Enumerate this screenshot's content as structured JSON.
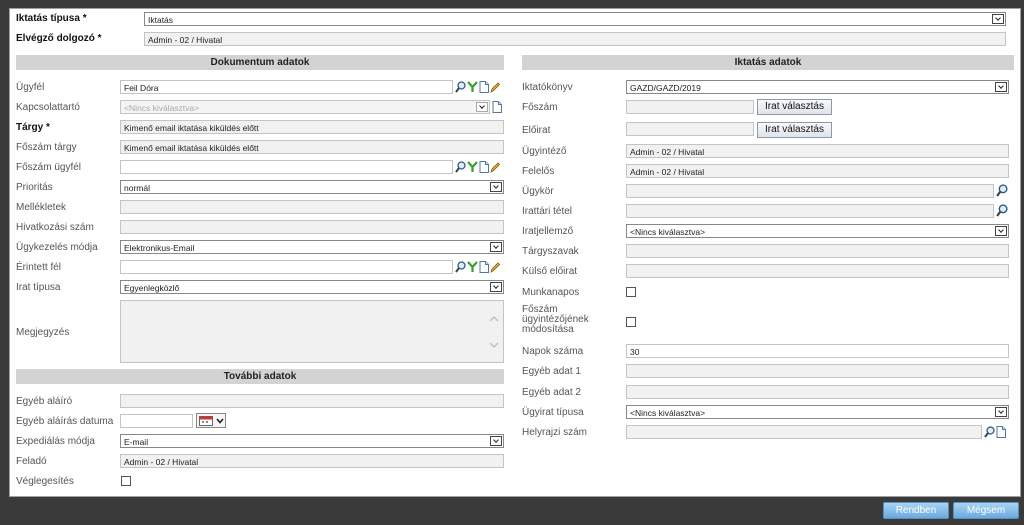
{
  "top": {
    "iktatas_tipusa_label": "Iktatás típusa *",
    "iktatas_tipusa_value": "Iktatás",
    "elvegzo_label": "Elvégző dolgozó *",
    "elvegzo_value": "Admin - 02 / Hivatal"
  },
  "left": {
    "section_title": "Dokumentum adatok",
    "ugyfel": {
      "label": "Ügyfél",
      "value": "Feil Dóra"
    },
    "kapcsolattarto": {
      "label": "Kapcsolattartó",
      "placeholder": "<Nincs kiválasztva>"
    },
    "targy": {
      "label": "Tárgy *",
      "value": "Kimenő email iktatása kiküldés előtt"
    },
    "foszam_targy": {
      "label": "Főszám tárgy",
      "value": "Kimenő email iktatása kiküldés előtt"
    },
    "foszam_ugyfel": {
      "label": "Főszám ügyfél",
      "value": ""
    },
    "prioritas": {
      "label": "Prioritás",
      "value": "normál"
    },
    "mellekletek": {
      "label": "Mellékletek",
      "value": ""
    },
    "hivatkozasi_szam": {
      "label": "Hivatkozási szám",
      "value": ""
    },
    "ugykezeles_modja": {
      "label": "Ügykezelés módja",
      "value": "Elektronikus-Email"
    },
    "erintett_fel": {
      "label": "Érintett fél",
      "value": ""
    },
    "irat_tipusa": {
      "label": "Irat típusa",
      "value": "Egyenlegközlő"
    },
    "megjegyzes": {
      "label": "Megjegyzés",
      "value": ""
    }
  },
  "further": {
    "section_title": "További adatok",
    "egyeb_alairo": {
      "label": "Egyéb aláíró",
      "value": ""
    },
    "egyeb_alairas_datuma": {
      "label": "Egyéb aláírás datuma",
      "value": ""
    },
    "expedialas_modja": {
      "label": "Expediálás módja",
      "value": "E-mail"
    },
    "felado": {
      "label": "Feladó",
      "value": "Admin - 02 / Hivatal"
    },
    "veglegesites": {
      "label": "Véglegesítés",
      "checked": false
    }
  },
  "right": {
    "section_title": "Iktatás adatok",
    "iktatokonyv": {
      "label": "Iktatókönyv",
      "value": "GAZD/GAZD/2019"
    },
    "foszam": {
      "label": "Főszám",
      "value": "",
      "button": "Irat választás"
    },
    "eloirat": {
      "label": "Előirat",
      "value": "",
      "button": "Irat választás"
    },
    "ugyintezo": {
      "label": "Ügyintéző",
      "value": "Admin - 02 / Hivatal"
    },
    "felelos": {
      "label": "Felelős",
      "value": "Admin - 02 / Hivatal"
    },
    "ugykor": {
      "label": "Ügykör",
      "value": ""
    },
    "irattari_tetel": {
      "label": "Irattári tétel",
      "value": ""
    },
    "iratjellemzo": {
      "label": "Iratjellemző",
      "value": "<Nincs kiválasztva>"
    },
    "targyszavak": {
      "label": "Tárgyszavak",
      "value": ""
    },
    "kulso_eloirat": {
      "label": "Külső előirat",
      "value": ""
    },
    "munkanapos": {
      "label": "Munkanapos",
      "checked": false
    },
    "foszam_mod": {
      "label_l1": "Főszám",
      "label_l2": "ügyintézőjének",
      "label_l3": "módosítása",
      "checked": false
    },
    "napok_szama": {
      "label": "Napok száma",
      "value": "30"
    },
    "egyeb_adat_1": {
      "label": "Egyéb adat 1",
      "value": ""
    },
    "egyeb_adat_2": {
      "label": "Egyéb adat 2",
      "value": ""
    },
    "ugyirat_tipusa": {
      "label": "Ügyirat típusa",
      "value": "<Nincs kiválasztva>"
    },
    "helyrajzi_szam": {
      "label": "Helyrajzi szám",
      "value": ""
    }
  },
  "footer": {
    "ok_label": "Rendben",
    "cancel_label": "Mégsem"
  },
  "colors": {
    "section_bg": "#d3d3d3",
    "footer_button": "#6aa9de",
    "background": "#3a3a3a"
  }
}
